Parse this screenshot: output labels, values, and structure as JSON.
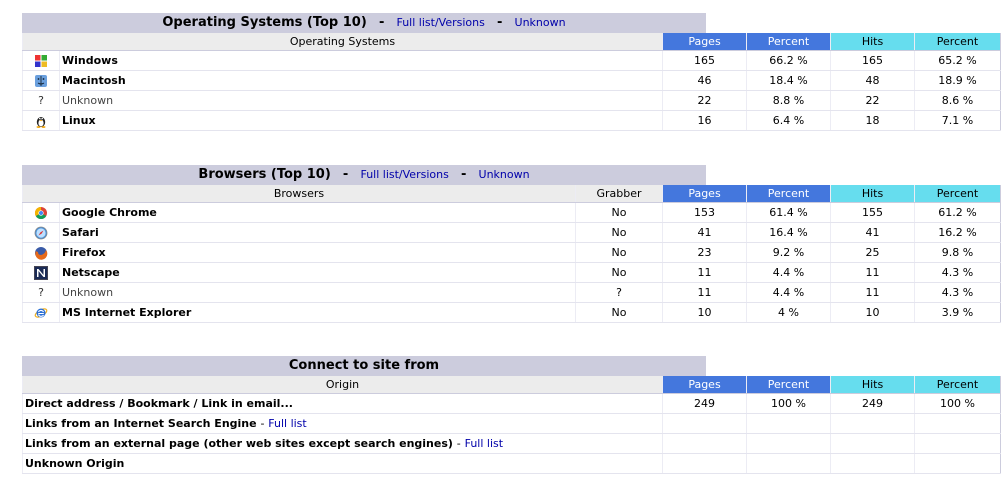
{
  "os": {
    "title": "Operating Systems (Top 10)",
    "link_full": "Full list/Versions",
    "link_unknown": "Unknown",
    "col_name": "Operating Systems",
    "col_pages": "Pages",
    "col_percent": "Percent",
    "col_hits": "Hits",
    "col_hits_percent": "Percent",
    "rows": [
      {
        "name": "Windows",
        "pages": "165",
        "pages_pct": "66.2 %",
        "hits": "165",
        "hits_pct": "65.2 %",
        "icon": "windows-icon"
      },
      {
        "name": "Macintosh",
        "pages": "46",
        "pages_pct": "18.4 %",
        "hits": "48",
        "hits_pct": "18.9 %",
        "icon": "macintosh-icon"
      },
      {
        "name": "Unknown",
        "pages": "22",
        "pages_pct": "8.8 %",
        "hits": "22",
        "hits_pct": "8.6 %",
        "icon": "question-icon"
      },
      {
        "name": "Linux",
        "pages": "16",
        "pages_pct": "6.4 %",
        "hits": "18",
        "hits_pct": "7.1 %",
        "icon": "linux-icon"
      }
    ]
  },
  "browsers": {
    "title": "Browsers (Top 10)",
    "link_full": "Full list/Versions",
    "link_unknown": "Unknown",
    "col_name": "Browsers",
    "col_grabber": "Grabber",
    "col_pages": "Pages",
    "col_percent": "Percent",
    "col_hits": "Hits",
    "col_hits_percent": "Percent",
    "rows": [
      {
        "name": "Google Chrome",
        "grabber": "No",
        "pages": "153",
        "pages_pct": "61.4 %",
        "hits": "155",
        "hits_pct": "61.2 %",
        "icon": "chrome-icon"
      },
      {
        "name": "Safari",
        "grabber": "No",
        "pages": "41",
        "pages_pct": "16.4 %",
        "hits": "41",
        "hits_pct": "16.2 %",
        "icon": "safari-icon"
      },
      {
        "name": "Firefox",
        "grabber": "No",
        "pages": "23",
        "pages_pct": "9.2 %",
        "hits": "25",
        "hits_pct": "9.8 %",
        "icon": "firefox-icon"
      },
      {
        "name": "Netscape",
        "grabber": "No",
        "pages": "11",
        "pages_pct": "4.4 %",
        "hits": "11",
        "hits_pct": "4.3 %",
        "icon": "netscape-icon"
      },
      {
        "name": "Unknown",
        "grabber": "?",
        "pages": "11",
        "pages_pct": "4.4 %",
        "hits": "11",
        "hits_pct": "4.3 %",
        "icon": "question-icon"
      },
      {
        "name": "MS Internet Explorer",
        "grabber": "No",
        "pages": "10",
        "pages_pct": "4 %",
        "hits": "10",
        "hits_pct": "3.9 %",
        "icon": "ie-icon"
      }
    ]
  },
  "origin": {
    "title": "Connect to site from",
    "col_name": "Origin",
    "col_pages": "Pages",
    "col_percent": "Percent",
    "col_hits": "Hits",
    "col_hits_percent": "Percent",
    "rows": [
      {
        "name": "Direct address / Bookmark / Link in email...",
        "link": "",
        "pages": "249",
        "pages_pct": "100 %",
        "hits": "249",
        "hits_pct": "100 %"
      },
      {
        "name": "Links from an Internet Search Engine",
        "link": "Full list",
        "pages": "",
        "pages_pct": "",
        "hits": "",
        "hits_pct": ""
      },
      {
        "name": "Links from an external page (other web sites except search engines)",
        "link": "Full list",
        "pages": "",
        "pages_pct": "",
        "hits": "",
        "hits_pct": ""
      },
      {
        "name": "Unknown Origin",
        "link": "",
        "pages": "",
        "pages_pct": "",
        "hits": "",
        "hits_pct": ""
      }
    ]
  },
  "colors": {
    "tab_bg": "#ccccdd",
    "pages_header": "#4477dd",
    "hits_header": "#66ddee",
    "link": "#0000aa"
  }
}
